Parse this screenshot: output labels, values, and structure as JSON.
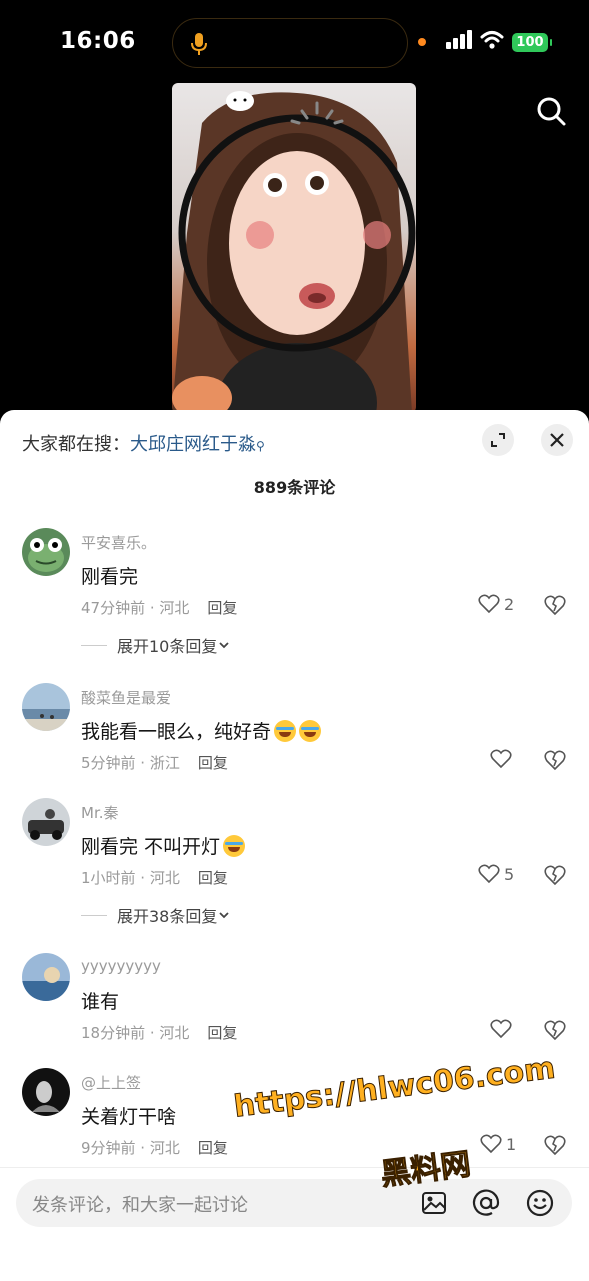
{
  "status_bar": {
    "time": "16:06",
    "battery": "100"
  },
  "sheet": {
    "search_prefix": "大家都在搜：",
    "search_keyword": "大邱庄网红于淼",
    "comment_count": "889条评论",
    "comments": [
      {
        "user": "平安喜乐。",
        "text": "刚看完",
        "time": "47分钟前 · 河北",
        "reply": "回复",
        "likes": "2",
        "more": "展开10条回复"
      },
      {
        "user": "酸菜鱼是最爱",
        "text": "我能看一眼么，纯好奇",
        "time": "5分钟前 · 浙江",
        "reply": "回复",
        "likes": ""
      },
      {
        "user": "Mr.秦",
        "text": "刚看完 不叫开灯",
        "time": "1小时前 · 河北",
        "reply": "回复",
        "likes": "5",
        "more": "展开38条回复"
      },
      {
        "user": "yyyyyyyyy",
        "text": "谁有",
        "time": "18分钟前 · 河北",
        "reply": "回复",
        "likes": ""
      },
      {
        "user": "@上上签",
        "text": "关着灯干啥",
        "time": "9分钟前 · 河北",
        "reply": "回复",
        "likes": "1"
      }
    ],
    "input_placeholder": "发条评论，和大家一起讨论"
  },
  "watermark": {
    "line1": "https://hlwc06.com",
    "line2": "黑料网"
  },
  "colors": {
    "accent_link": "#2a5a8a",
    "battery": "#30c85a",
    "watermark": "#ffb020"
  },
  "icons": [
    "mic-icon",
    "signal-icon",
    "wifi-icon",
    "search-icon",
    "expand-icon",
    "close-icon",
    "heart-icon",
    "broken-heart-icon",
    "chevron-down-icon",
    "image-icon",
    "at-icon",
    "emoji-icon"
  ]
}
